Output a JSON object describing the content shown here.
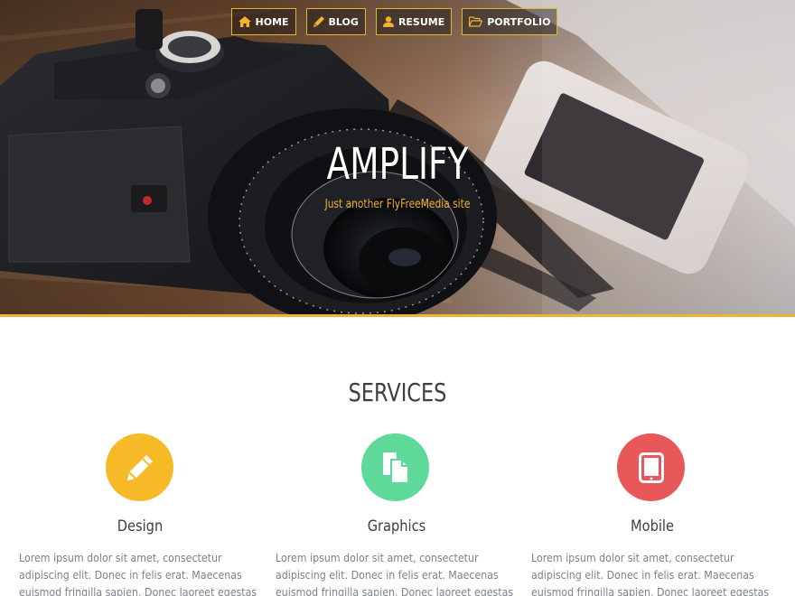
{
  "nav": {
    "items": [
      {
        "label": "HOME",
        "icon": "home-icon"
      },
      {
        "label": "BLOG",
        "icon": "pencil-icon"
      },
      {
        "label": "RESUME",
        "icon": "user-icon"
      },
      {
        "label": "PORTFOLIO",
        "icon": "folder-open-icon"
      }
    ]
  },
  "hero": {
    "title": "AMPLIFY",
    "tagline": "Just another FlyFreeMedia site"
  },
  "services": {
    "heading": "SERVICES",
    "items": [
      {
        "name": "Design",
        "icon": "pencil-icon",
        "color": "#f6b928",
        "text": "Lorem ipsum dolor sit amet, consectetur adipiscing elit. Donec in felis erat. Maecenas euismod fringilla sapien. Donec laoreet egestas"
      },
      {
        "name": "Graphics",
        "icon": "documents-icon",
        "color": "#5ed99a",
        "text": "Lorem ipsum dolor sit amet, consectetur adipiscing elit. Donec in felis erat. Maecenas euismod fringilla sapien. Donec laoreet egestas"
      },
      {
        "name": "Mobile",
        "icon": "tablet-icon",
        "color": "#e8585a",
        "text": "Lorem ipsum dolor sit amet, consectetur adipiscing elit. Donec in felis erat. Maecenas euismod fringilla sapien. Donec laoreet egestas"
      }
    ]
  },
  "colors": {
    "accent": "#f2b22f",
    "heading": "#3a3f46",
    "body_text": "#7b8189"
  }
}
